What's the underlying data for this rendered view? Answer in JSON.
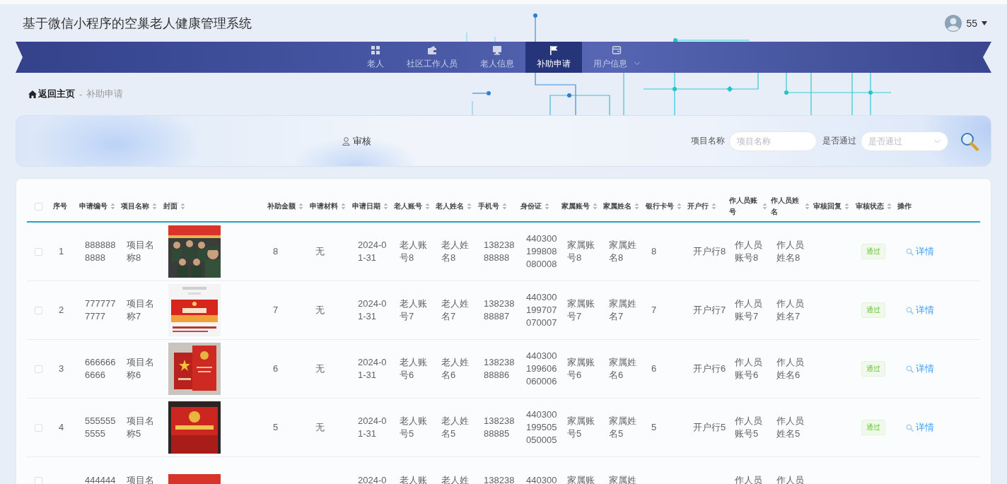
{
  "header": {
    "title": "基于微信小程序的空巢老人健康管理系统",
    "user": {
      "name": "55"
    }
  },
  "nav": [
    {
      "label": "老人",
      "selected": false,
      "dropdown": false
    },
    {
      "label": "社区工作人员",
      "selected": false,
      "dropdown": false
    },
    {
      "label": "老人信息",
      "selected": false,
      "dropdown": false
    },
    {
      "label": "补助申请",
      "selected": true,
      "dropdown": false
    },
    {
      "label": "用户信息",
      "selected": false,
      "dropdown": true
    }
  ],
  "breadcrumb": {
    "home": "返回主页",
    "separator": "-",
    "current": "补助申请"
  },
  "toolbar": {
    "audit_button": "审核",
    "filters": [
      {
        "kind": "input",
        "label": "项目名称",
        "placeholder": "项目名称"
      },
      {
        "kind": "select",
        "label": "是否通过",
        "placeholder": "是否通过"
      }
    ]
  },
  "table": {
    "select_all": {
      "checked": false
    },
    "columns": [
      {
        "label": "序号",
        "sortable": false
      },
      {
        "label": "申请编号",
        "sortable": true
      },
      {
        "label": "项目名称",
        "sortable": true
      },
      {
        "label": "封面",
        "sortable": true
      },
      {
        "label": "补助金额",
        "sortable": true
      },
      {
        "label": "申请材料",
        "sortable": true
      },
      {
        "label": "申请日期",
        "sortable": true
      },
      {
        "label": "老人账号",
        "sortable": true
      },
      {
        "label": "老人姓名",
        "sortable": true
      },
      {
        "label": "手机号",
        "sortable": true
      },
      {
        "label": "身份证",
        "sortable": true
      },
      {
        "label": "家属账号",
        "sortable": true
      },
      {
        "label": "家属姓名",
        "sortable": true
      },
      {
        "label": "银行卡号",
        "sortable": true
      },
      {
        "label": "开户行",
        "sortable": true
      },
      {
        "label": "作人员账号",
        "sortable": true
      },
      {
        "label": "作人员姓名",
        "sortable": true
      },
      {
        "label": "审核回复",
        "sortable": true
      },
      {
        "label": "审核状态",
        "sortable": true
      },
      {
        "label": "操作",
        "sortable": false
      }
    ],
    "rows": [
      {
        "checked": false,
        "clipped": false,
        "cells": [
          "1",
          "8888888888",
          "项目名称8",
          "",
          "8",
          "无",
          "2024-01-31",
          "老人账号8",
          "老人姓名8",
          "13823888888",
          "440300199808080008",
          "家属账号8",
          "家属姓名8",
          "8",
          "开户行8",
          "作人员账号8",
          "作人员姓名8",
          "",
          "通过",
          "详情"
        ]
      },
      {
        "checked": false,
        "clipped": false,
        "cells": [
          "2",
          "7777777777",
          "项目名称7",
          "",
          "7",
          "无",
          "2024-01-31",
          "老人账号7",
          "老人姓名7",
          "13823888887",
          "440300199707070007",
          "家属账号7",
          "家属姓名7",
          "7",
          "开户行7",
          "作人员账号7",
          "作人员姓名7",
          "",
          "通过",
          "详情"
        ]
      },
      {
        "checked": false,
        "clipped": false,
        "cells": [
          "3",
          "6666666666",
          "项目名称6",
          "",
          "6",
          "无",
          "2024-01-31",
          "老人账号6",
          "老人姓名6",
          "13823888886",
          "440300199606060006",
          "家属账号6",
          "家属姓名6",
          "6",
          "开户行6",
          "作人员账号6",
          "作人员姓名6",
          "",
          "通过",
          "详情"
        ]
      },
      {
        "checked": false,
        "clipped": false,
        "cells": [
          "4",
          "5555555555",
          "项目名称5",
          "",
          "5",
          "无",
          "2024-01-31",
          "老人账号5",
          "老人姓名5",
          "13823888885",
          "440300199505050005",
          "家属账号5",
          "家属姓名5",
          "5",
          "开户行5",
          "作人员账号5",
          "作人员姓名5",
          "",
          "通过",
          "详情"
        ]
      },
      {
        "checked": false,
        "clipped": true,
        "cells": [
          "",
          "444444",
          "项目名",
          "",
          "",
          "",
          "2024-0",
          "老人账",
          "老人姓",
          "138238",
          "440300",
          "家属账",
          "家属姓",
          "",
          "",
          "作人员",
          "作人员",
          "",
          "",
          ""
        ]
      }
    ]
  }
}
